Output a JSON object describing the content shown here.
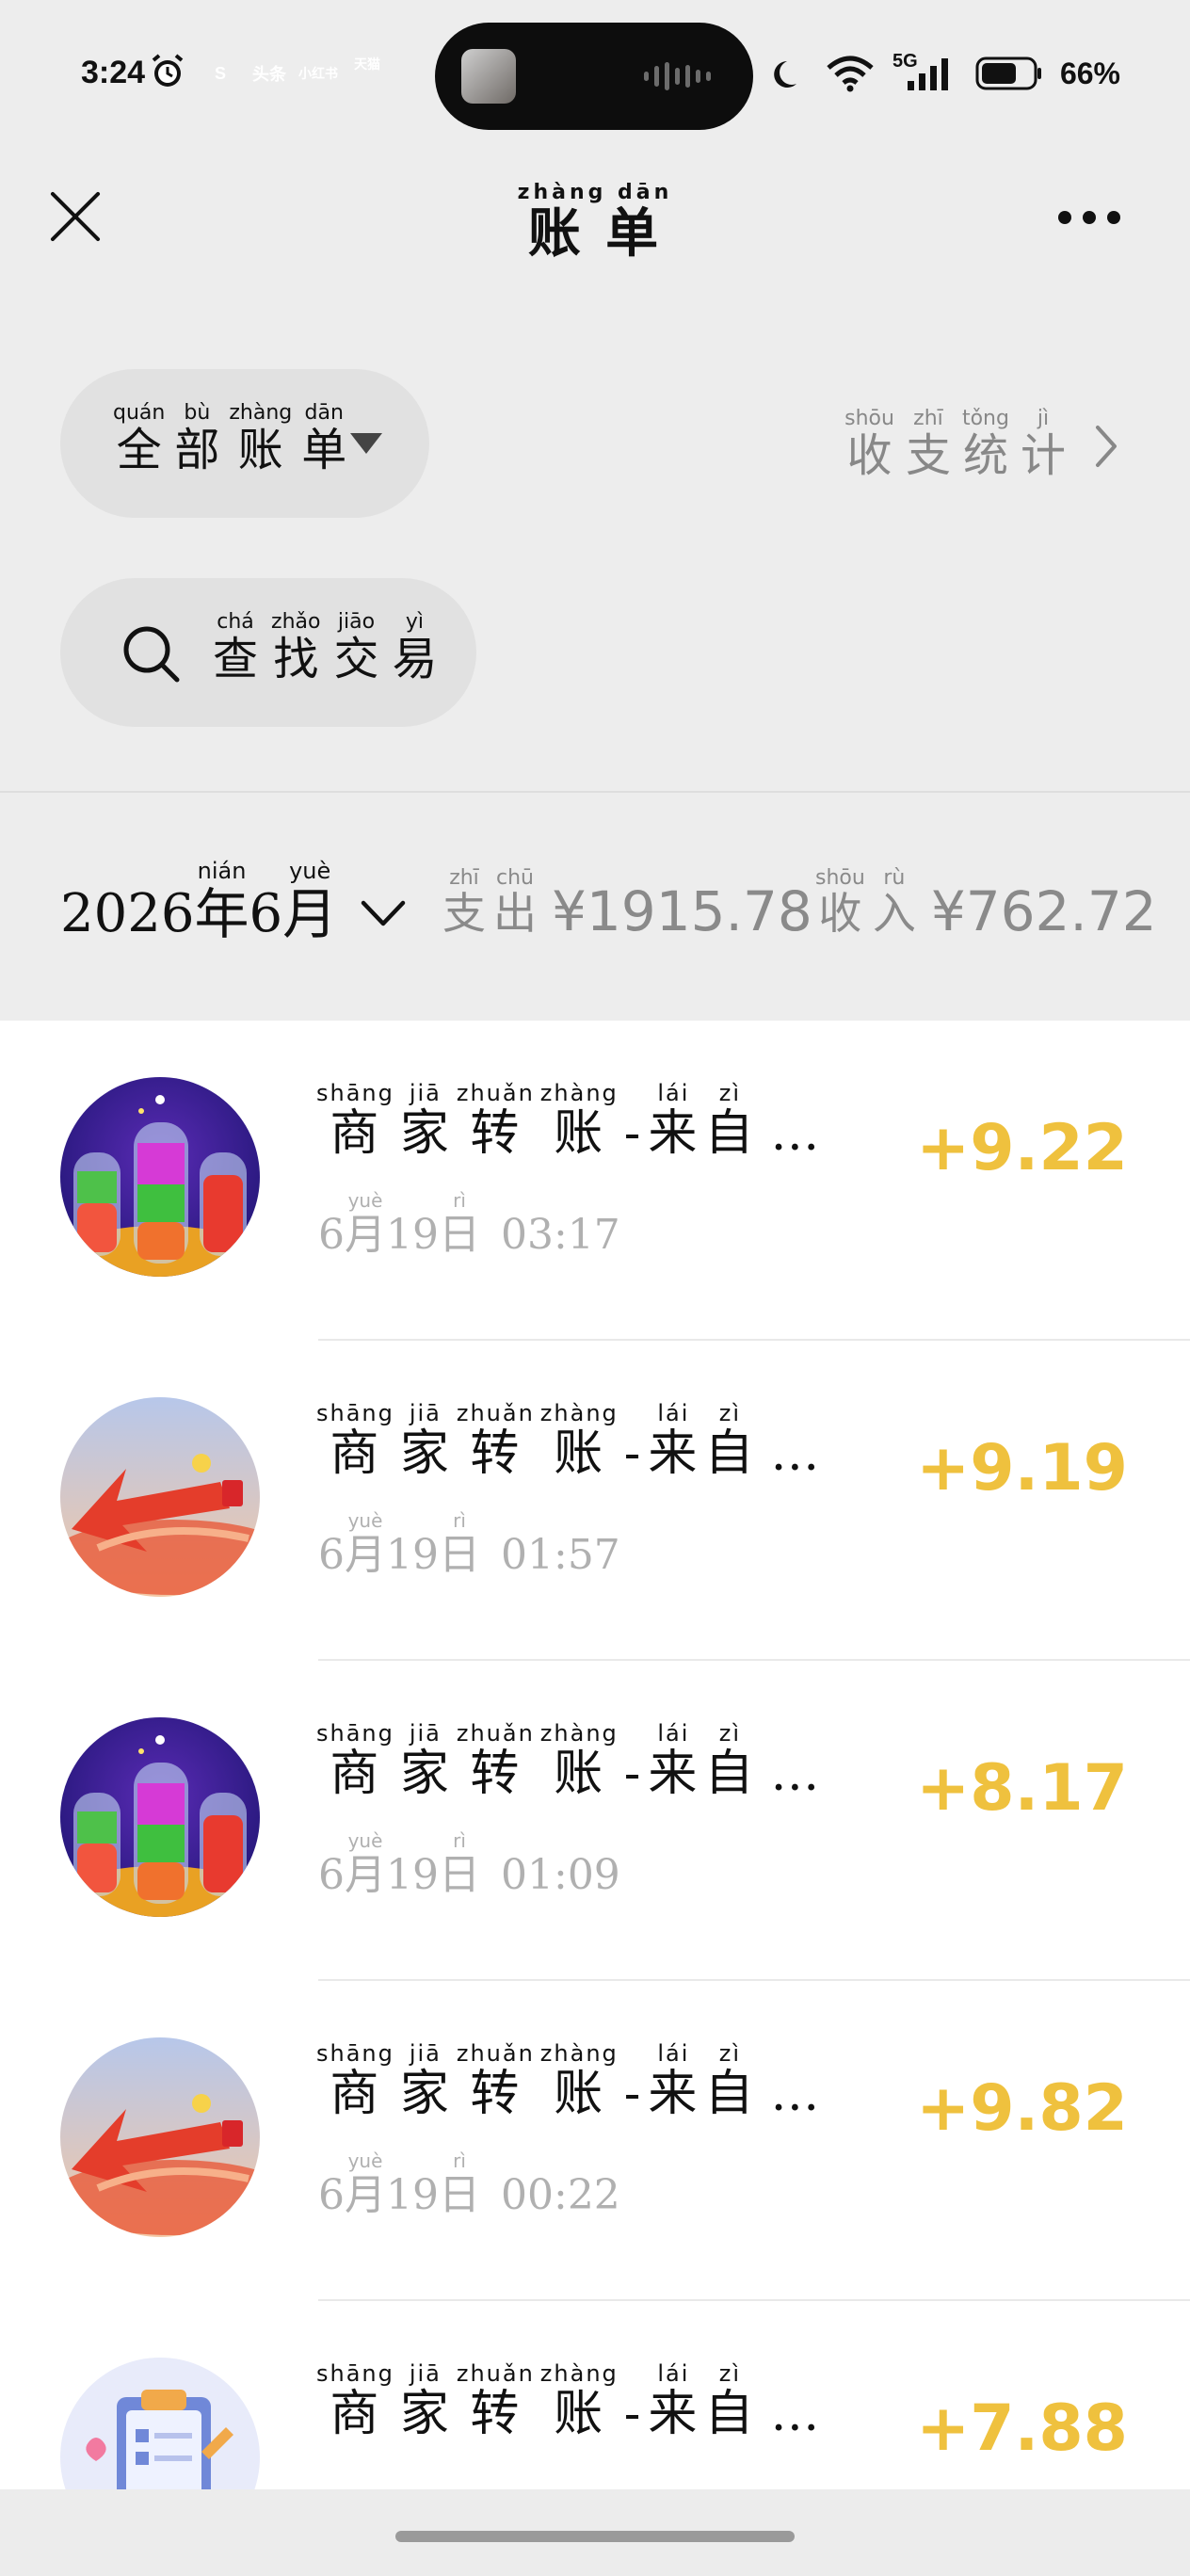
{
  "status_bar": {
    "time": "3:24",
    "apps": [
      {
        "label": "S",
        "color": "#e3493b"
      },
      {
        "label": "头条",
        "color": "#e8372f"
      },
      {
        "label": "小红书",
        "color": "#e5263a"
      },
      {
        "label": "天猫",
        "color": "#d8252a"
      }
    ],
    "network": "5G",
    "sim": "6",
    "battery_percent": "66%"
  },
  "header": {
    "title": "账单",
    "title_pinyin": "zhàng dān"
  },
  "filter": {
    "chars": [
      {
        "c": "全",
        "p": "quán"
      },
      {
        "c": "部",
        "p": "bù"
      },
      {
        "c": "账",
        "p": "zhàng"
      },
      {
        "c": "单",
        "p": "dān"
      }
    ]
  },
  "stats_link": {
    "chars": [
      {
        "c": "收",
        "p": "shōu"
      },
      {
        "c": "支",
        "p": "zhī"
      },
      {
        "c": "统",
        "p": "tǒng"
      },
      {
        "c": "计",
        "p": "jì"
      }
    ]
  },
  "search": {
    "chars": [
      {
        "c": "查",
        "p": "chá"
      },
      {
        "c": "找",
        "p": "zhǎo"
      },
      {
        "c": "交",
        "p": "jiāo"
      },
      {
        "c": "易",
        "p": "yì"
      }
    ]
  },
  "summary": {
    "year": "2026",
    "year_char": {
      "c": "年",
      "p": "nián"
    },
    "month": "6",
    "month_char": {
      "c": "月",
      "p": "yuè"
    },
    "expense_chars": [
      {
        "c": "支",
        "p": "zhī"
      },
      {
        "c": "出",
        "p": "chū"
      }
    ],
    "expense_amount": "¥1915.78",
    "income_chars": [
      {
        "c": "收",
        "p": "shōu"
      },
      {
        "c": "入",
        "p": "rù"
      }
    ],
    "income_amount": "¥762.72"
  },
  "transactions": [
    {
      "month": "6",
      "day": "19",
      "time": "03:17",
      "amount": "+9.22",
      "avatar": "bottles-icon"
    },
    {
      "month": "6",
      "day": "19",
      "time": "01:57",
      "amount": "+9.19",
      "avatar": "arrow-icon"
    },
    {
      "month": "6",
      "day": "19",
      "time": "01:09",
      "amount": "+8.17",
      "avatar": "bottles-icon"
    },
    {
      "month": "6",
      "day": "19",
      "time": "00:22",
      "amount": "+9.82",
      "avatar": "arrow-icon"
    },
    {
      "month": "",
      "day": "",
      "time": "",
      "amount": "+7.88",
      "avatar": "clipboard-icon"
    }
  ],
  "transaction_title": {
    "chars": [
      {
        "c": "商",
        "p": "shāng"
      },
      {
        "c": "家",
        "p": "jiā"
      },
      {
        "c": "转",
        "p": "zhuǎn"
      },
      {
        "c": "账",
        "p": "zhàng"
      },
      {
        "c": "-",
        "p": ""
      },
      {
        "c": "来",
        "p": "lái"
      },
      {
        "c": "自",
        "p": "zì"
      }
    ],
    "ellipsis": "…"
  },
  "date_chars": {
    "month": {
      "c": "月",
      "p": "yuè"
    },
    "day": {
      "c": "日",
      "p": "rì"
    }
  },
  "colors": {
    "amount": "#efc13e",
    "background": "#ededed",
    "list_bg": "#ffffff"
  }
}
